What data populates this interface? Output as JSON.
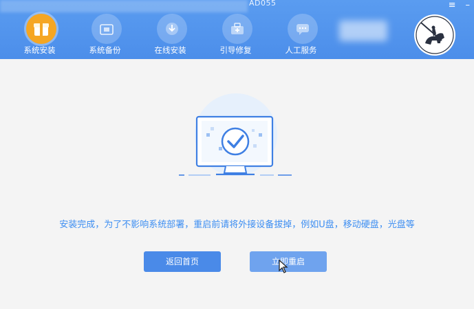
{
  "window": {
    "title_fragment": "AD055",
    "controls": [
      "≡",
      "–"
    ]
  },
  "nav": {
    "items": [
      {
        "label": "系统安装",
        "icon": "package-icon",
        "active": true
      },
      {
        "label": "系统备份",
        "icon": "backup-icon",
        "active": false
      },
      {
        "label": "在线安装",
        "icon": "download-icon",
        "active": false
      },
      {
        "label": "引导修复",
        "icon": "toolbox-icon",
        "active": false
      },
      {
        "label": "人工服务",
        "icon": "chat-icon",
        "active": false
      }
    ]
  },
  "main": {
    "status_icon": "monitor-check-icon",
    "message": "安装完成，为了不影响系统部署，重启前请将外接设备拔掉，例如U盘，移动硬盘，光盘等",
    "buttons": {
      "home": "返回首页",
      "restart": "立即重启"
    }
  },
  "colors": {
    "header": "#4c8eea",
    "accent_active": "#f5a623",
    "text_accent": "#3d8ef2",
    "button_primary": "#4a8ae8",
    "button_hover": "#6fa3ee"
  }
}
